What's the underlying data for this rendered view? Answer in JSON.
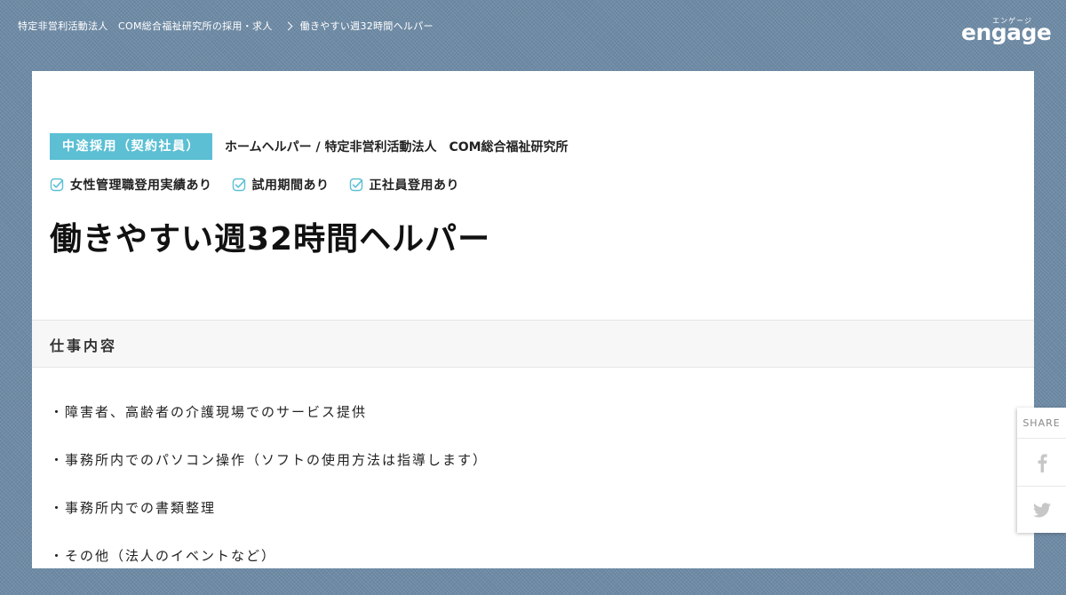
{
  "breadcrumb": {
    "company_link": "特定非営利活動法人　COM総合福祉研究所の採用・求人",
    "current": "働きやすい週32時間ヘルパー"
  },
  "logo": {
    "kana": "エンゲージ",
    "text": "engage"
  },
  "job": {
    "tag": "中途採用（契約社員）",
    "position_company": "ホームヘルパー / 特定非営利活動法人　COM総合福祉研究所",
    "features": [
      "女性管理職登用実績あり",
      "試用期間あり",
      "正社員登用あり"
    ],
    "title": "働きやすい週32時間ヘルパー"
  },
  "section": {
    "title": "仕事内容",
    "lines": [
      "・障害者、高齢者の介護現場でのサービス提供",
      "・事務所内でのパソコン操作（ソフトの使用方法は指導します）",
      "・事務所内での書類整理",
      "・その他（法人のイベントなど）"
    ]
  },
  "share": {
    "label": "SHARE"
  },
  "colors": {
    "accent": "#5cbfd4",
    "background": "#6d8aa5"
  },
  "icons": [
    "chevron-right-icon",
    "check-icon",
    "facebook-icon",
    "twitter-icon"
  ]
}
